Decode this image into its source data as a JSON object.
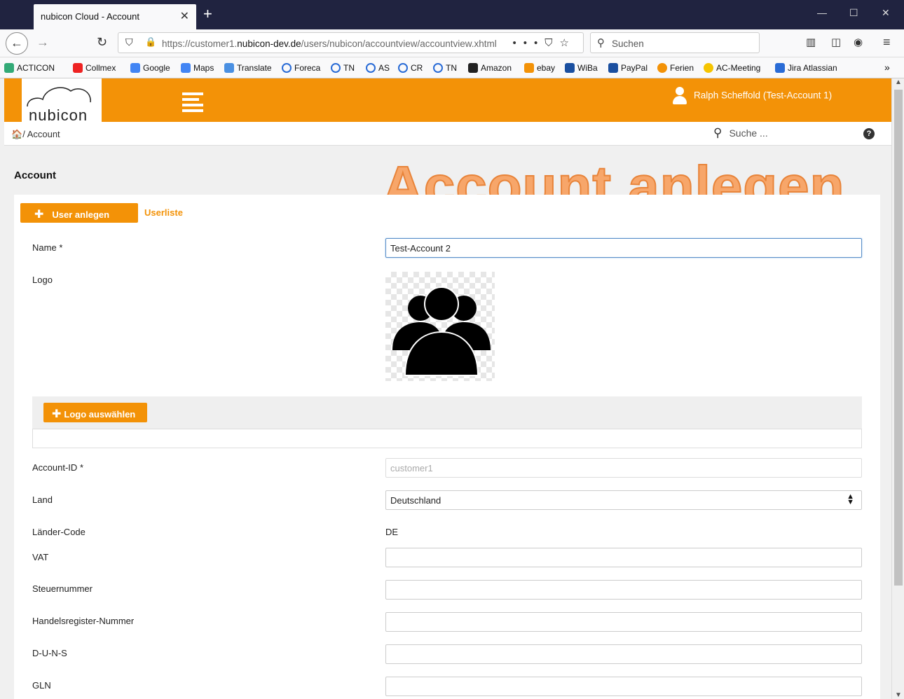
{
  "browser": {
    "tab_title": "nubicon Cloud - Account",
    "url_prefix": "https://customer1.",
    "url_domain": "nubicon-dev.de",
    "url_path": "/users/nubicon/accountview/accountview.xhtml",
    "search_placeholder": "Suchen",
    "bookmarks": [
      "ACTICON",
      "Collmex",
      "Google",
      "Maps",
      "Translate",
      "Foreca",
      "TN",
      "AS",
      "CR",
      "TN",
      "Amazon",
      "ebay",
      "WiBa",
      "PayPal",
      "Ferien",
      "AC-Meeting",
      "Jira Atlassian"
    ]
  },
  "header": {
    "logo_text": "nubicon",
    "user_name": "Ralph Scheffold (Test-Account 1)"
  },
  "breadcrumb": {
    "current": "/ Account",
    "search_placeholder": "Suche ...",
    "help": "?"
  },
  "page": {
    "title": "Account",
    "watermark": "Account anlegen",
    "btn_user_add": "User anlegen",
    "link_userlist": "Userliste",
    "btn_logo_select": "Logo auswählen"
  },
  "form": {
    "name_label": "Name",
    "name_value": "Test-Account 2",
    "required_mark": "*",
    "logo_label": "Logo",
    "account_id_label": "Account-ID",
    "account_id_placeholder": "customer1",
    "land_label": "Land",
    "land_value": "Deutschland",
    "laender_code_label": "Länder-Code",
    "laender_code_value": "DE",
    "vat_label": "VAT",
    "steuernummer_label": "Steuernummer",
    "handelsregister_label": "Handelsregister-Nummer",
    "duns_label": "D-U-N-S",
    "gln_label": "GLN"
  },
  "colors": {
    "accent": "#f39207",
    "watermark": "#f7a66a"
  }
}
